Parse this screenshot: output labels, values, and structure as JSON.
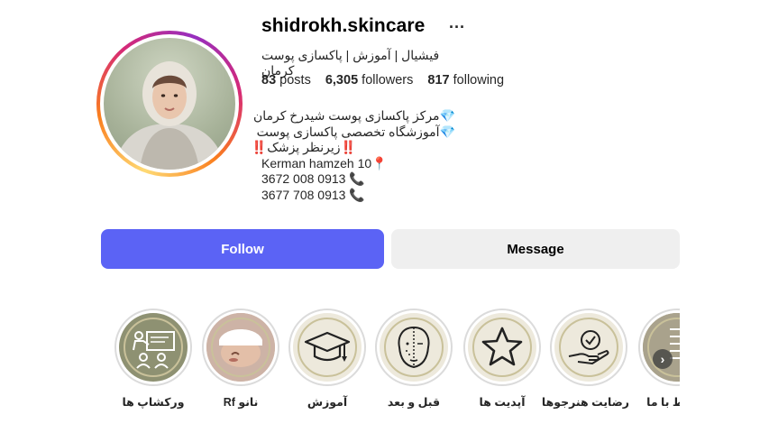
{
  "profile": {
    "username": "shidrokh.skincare",
    "more": "···",
    "full_name": "فیشیال | آموزش | پاکسازی پوست کرمان"
  },
  "stats": {
    "posts_count": "83",
    "posts_label": "posts",
    "followers_count": "6,305",
    "followers_label": "followers",
    "following_count": "817",
    "following_label": "following"
  },
  "bio": {
    "line1": "💎مرکز پاکسازی پوست شیدرخ کرمان",
    "line2": "💎آموزشگاه تخصصی پاکسازی پوست",
    "line3": "‼️زیرنظر پزشک‼️",
    "line4": "Kerman hamzeh 10📍",
    "line5": "3672 008 0913 📞",
    "line6": "3677 708 0913 📞"
  },
  "actions": {
    "follow_label": "Follow",
    "message_label": "Message"
  },
  "highlights": [
    {
      "label": "ورکشاپ ها",
      "icon": "teaching-icon"
    },
    {
      "label": "نانو Rf",
      "icon": "photo-face"
    },
    {
      "label": "آموزش",
      "icon": "graduation-cap-icon"
    },
    {
      "label": "قبل و بعد",
      "icon": "face-profile-icon"
    },
    {
      "label": "آپدیت ها",
      "icon": "star-icon"
    },
    {
      "label": "رضایت هنرجوها",
      "icon": "hand-badge-icon"
    },
    {
      "label": "ارتباط با ما",
      "icon": "photo-text"
    }
  ],
  "colors": {
    "follow_bg": "#5b63f5",
    "message_bg": "#efefef",
    "story_ring": "gradient instagram"
  }
}
